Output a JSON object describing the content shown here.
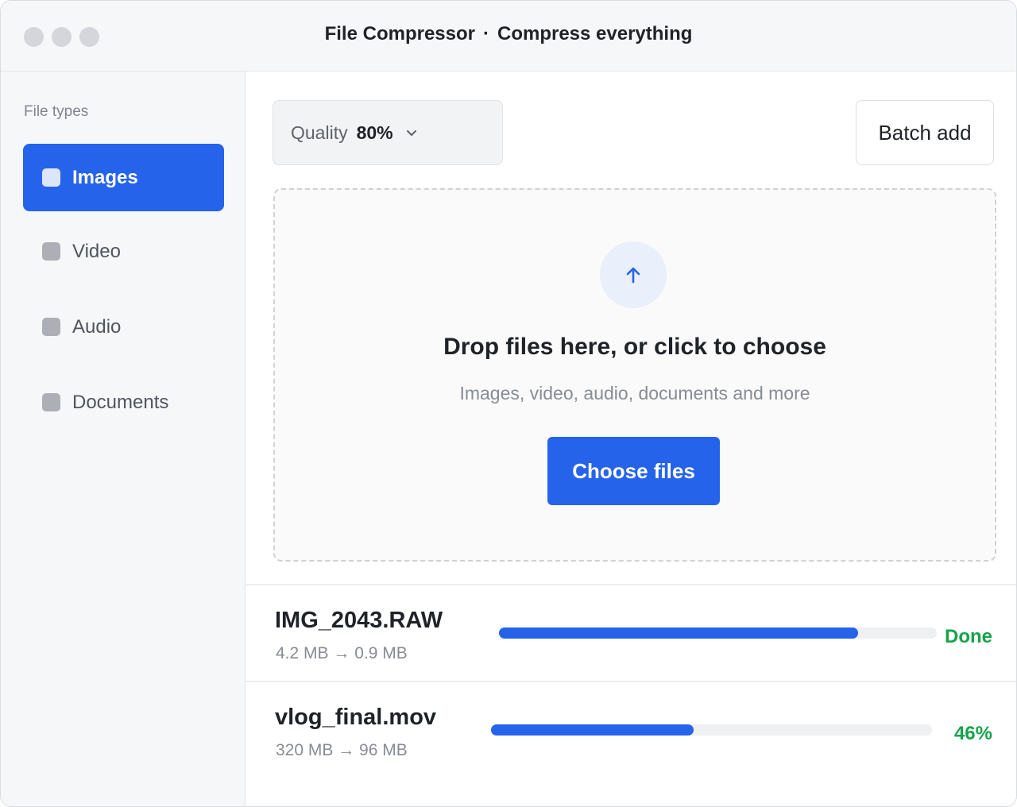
{
  "window": {
    "app_name": "File Compressor",
    "separator": "·",
    "tagline": "Compress everything"
  },
  "sidebar": {
    "heading": "File types",
    "items": [
      {
        "label": "Images",
        "active": true
      },
      {
        "label": "Video",
        "active": false
      },
      {
        "label": "Audio",
        "active": false
      },
      {
        "label": "Documents",
        "active": false
      }
    ]
  },
  "toolbar": {
    "quality_label": "Quality",
    "quality_value": "80%",
    "batch_label": "Batch add"
  },
  "dropzone": {
    "icon": "arrow-up-icon",
    "title": "Drop files here, or click to choose",
    "subtitle": "Images, video, audio, documents and more",
    "button_label": "Choose files"
  },
  "files": [
    {
      "name": "IMG_2043.RAW",
      "sizes": "4.2 MB → 0.9 MB",
      "progress": 0.82,
      "status": "Done"
    },
    {
      "name": "vlog_final.mov",
      "sizes": "320 MB → 96 MB",
      "progress": 0.46,
      "status": "46%"
    }
  ],
  "colors": {
    "accent": "#2563eb",
    "success": "#16a34a",
    "track": "#eef0f2"
  }
}
